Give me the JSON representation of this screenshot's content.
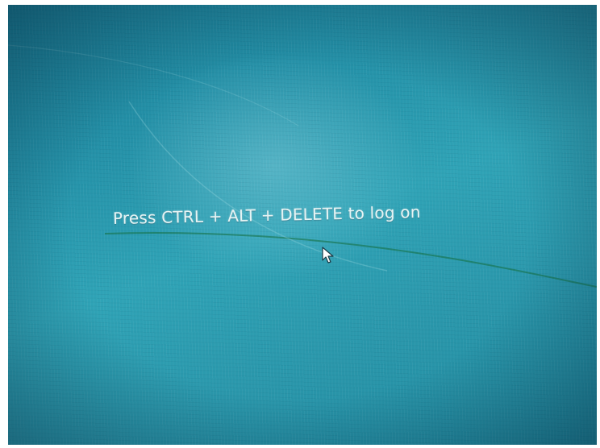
{
  "lock_screen": {
    "message": "Press CTRL + ALT + DELETE to log on"
  },
  "icons": {
    "cursor": "mouse-pointer-icon"
  },
  "colors": {
    "background": "#2a97ab",
    "text": "#e6f4f4"
  }
}
